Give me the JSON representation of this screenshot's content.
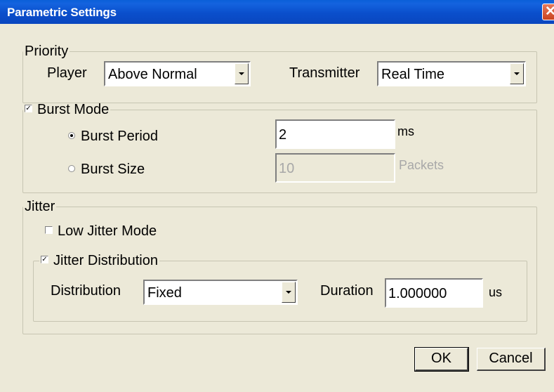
{
  "window": {
    "title": "Parametric Settings",
    "close_glyph": "✕"
  },
  "priority": {
    "legend": "Priority",
    "player_label": "Player",
    "player_value": "Above Normal",
    "transmitter_label": "Transmitter",
    "transmitter_value": "Real Time"
  },
  "burst": {
    "legend": "Burst Mode",
    "enabled": true,
    "period_label": "Burst Period",
    "period_selected": true,
    "period_value": "2",
    "period_unit": "ms",
    "size_label": "Burst Size",
    "size_value": "10",
    "size_unit": "Packets"
  },
  "jitter": {
    "legend": "Jitter",
    "low_jitter_label": "Low Jitter Mode",
    "low_jitter_checked": false,
    "distribution_group_label": "Jitter Distribution",
    "distribution_group_checked": true,
    "distribution_label": "Distribution",
    "distribution_value": "Fixed",
    "duration_label": "Duration",
    "duration_value": "1.000000",
    "duration_unit": "us"
  },
  "buttons": {
    "ok": "OK",
    "cancel": "Cancel"
  },
  "icons": {
    "check_glyph": "✓"
  },
  "colors": {
    "titlebar": "#0a4fcc",
    "dialog_bg": "#ece9d8",
    "disabled_text": "#a8a8a8"
  }
}
